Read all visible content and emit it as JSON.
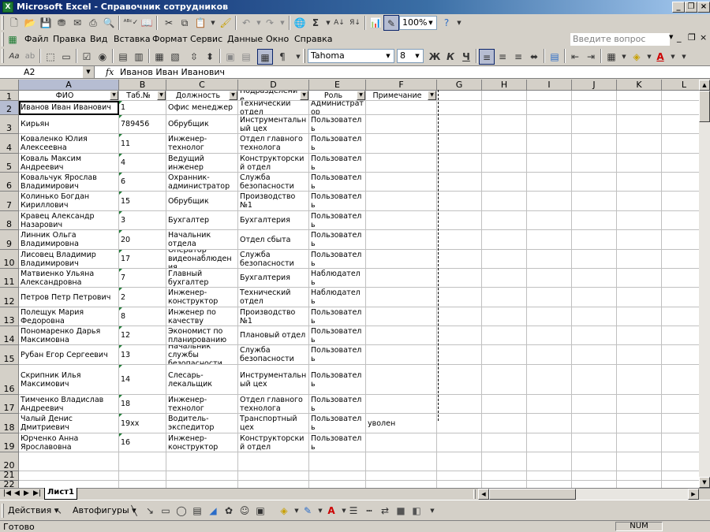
{
  "window": {
    "title": "Microsoft Excel - Справочник сотрудников",
    "app_icon": "excel-icon"
  },
  "menu": {
    "items": [
      "Файл",
      "Правка",
      "Вид",
      "Вставка",
      "Формат",
      "Сервис",
      "Данные",
      "Окно",
      "Справка"
    ],
    "help_placeholder": "Введите вопрос"
  },
  "toolbar": {
    "zoom": "100%",
    "font": "Tahoma",
    "size": "8",
    "bold": "Ж",
    "italic": "К",
    "underline": "Ч"
  },
  "formula_bar": {
    "name_box": "A2",
    "fx": "fx",
    "value": "Иванов Иван Иванович"
  },
  "columns": [
    "A",
    "B",
    "C",
    "D",
    "E",
    "F",
    "G",
    "H",
    "I",
    "J",
    "K",
    "L"
  ],
  "header_row": [
    "ФИО",
    "Таб.№",
    "Должность",
    "Подразделение",
    "Роль",
    "Примечание"
  ],
  "rows": [
    {
      "n": "2",
      "c": [
        "Иванов Иван Иванович",
        "1",
        "Офис менеджер",
        "Технический отдел",
        "Администратор",
        ""
      ]
    },
    {
      "n": "3",
      "c": [
        "Кирьян",
        "789456",
        "Обрубщик",
        "Инструментальный цех",
        "Пользователь",
        ""
      ]
    },
    {
      "n": "4",
      "c": [
        "Коваленко Юлия Алексеевна",
        "11",
        "Инженер-технолог",
        "Отдел главного технолога",
        "Пользователь",
        ""
      ]
    },
    {
      "n": "5",
      "c": [
        "Коваль Максим Андреевич",
        "4",
        "Ведущий инженер",
        "Конструкторский отдел",
        "Пользователь",
        ""
      ]
    },
    {
      "n": "6",
      "c": [
        "Ковальчук Ярослав Владимирович",
        "6",
        "Охранник-администратор",
        "Служба безопасности",
        "Пользователь",
        ""
      ]
    },
    {
      "n": "7",
      "c": [
        "Колинько Богдан Кириллович",
        "15",
        "Обрубщик",
        "Производство №1",
        "Пользователь",
        ""
      ]
    },
    {
      "n": "8",
      "c": [
        "Кравец Александр Назарович",
        "3",
        "Бухгалтер",
        "Бухгалтерия",
        "Пользователь",
        ""
      ]
    },
    {
      "n": "9",
      "c": [
        "Линник Ольга Владимировна",
        "20",
        "Начальник отдела",
        "Отдел сбыта",
        "Пользователь",
        ""
      ]
    },
    {
      "n": "10",
      "c": [
        "Лисовец Владимир Владимирович",
        "17",
        "Оператор видеонаблюдения",
        "Служба безопасности",
        "Пользователь",
        ""
      ]
    },
    {
      "n": "11",
      "c": [
        "Матвиенко Ульяна Александровна",
        "7",
        "Главный бухгалтер",
        "Бухгалтерия",
        "Наблюдатель",
        ""
      ]
    },
    {
      "n": "12",
      "c": [
        "Петров Петр Петрович",
        "2",
        "Инженер-конструктор",
        "Технический отдел",
        "Наблюдатель",
        ""
      ]
    },
    {
      "n": "13",
      "c": [
        "Полещук Мария Федоровна",
        "8",
        "Инженер по качеству",
        "Производство №1",
        "Пользователь",
        ""
      ]
    },
    {
      "n": "14",
      "c": [
        "Пономаренко Дарья Максимовна",
        "12",
        "Экономист по планированию",
        "Плановый отдел",
        "Пользователь",
        ""
      ]
    },
    {
      "n": "15",
      "c": [
        "Рубан Егор Сергеевич",
        "13",
        "Начальник службы безопасности",
        "Служба безопасности",
        "Пользователь",
        ""
      ]
    },
    {
      "n": "16",
      "c": [
        "Скрипник Илья Максимович",
        "14",
        "Слесарь-лекальщик",
        "Инструментальный цех",
        "Пользователь",
        ""
      ]
    },
    {
      "n": "17",
      "c": [
        "Тимченко Владислав Андреевич",
        "18",
        "Инженер-технолог",
        "Отдел главного технолога",
        "Пользователь",
        ""
      ]
    },
    {
      "n": "18",
      "c": [
        "Чалый Денис Дмитриевич",
        "19хх",
        "Водитель-экспедитор",
        "Транспортный цех",
        "Пользователь",
        "уволен"
      ]
    },
    {
      "n": "19",
      "c": [
        "Юрченко Анна Ярославовна",
        "16",
        "Инженер-конструктор",
        "Конструкторский отдел",
        "Пользователь",
        ""
      ]
    },
    {
      "n": "20",
      "c": [
        "",
        "",
        "",
        "",
        "",
        ""
      ]
    },
    {
      "n": "21",
      "c": [
        "",
        "",
        "",
        "",
        "",
        ""
      ]
    },
    {
      "n": "22",
      "c": [
        "",
        "",
        "",
        "",
        "",
        ""
      ]
    }
  ],
  "sheet_tab": "Лист1",
  "draw": {
    "actions": "Действия",
    "autoshapes": "Автофигуры"
  },
  "status": {
    "ready": "Готово",
    "num": "NUM"
  }
}
